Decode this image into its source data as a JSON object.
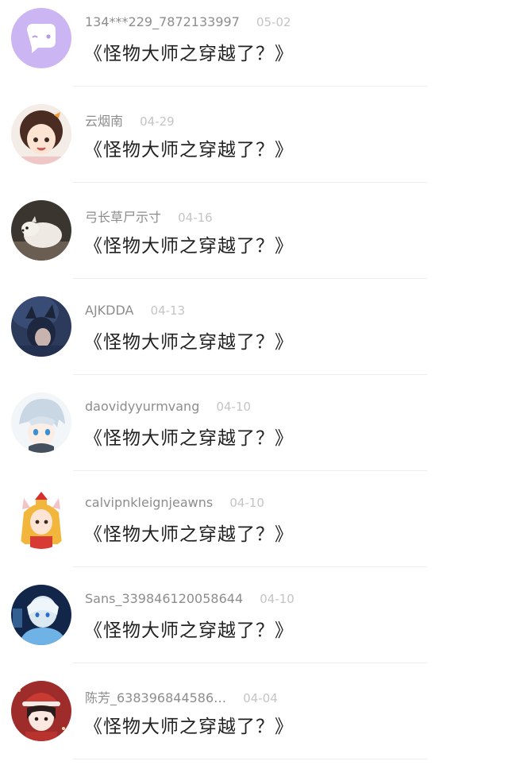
{
  "items": [
    {
      "name": "134***229_7872133997",
      "date": "05-02",
      "title": "《怪物大师之穿越了？》",
      "avatar": "chat-bubble-avatar"
    },
    {
      "name": "云烟南",
      "date": "04-29",
      "title": "《怪物大师之穿越了？》",
      "avatar": "anime-girl-avatar"
    },
    {
      "name": "弓长草尸示寸",
      "date": "04-16",
      "title": "《怪物大师之穿越了？》",
      "avatar": "white-fox-avatar"
    },
    {
      "name": "AJKDDA",
      "date": "04-13",
      "title": "《怪物大师之穿越了？》",
      "avatar": "dark-anime-avatar"
    },
    {
      "name": "daovidyyurmvang",
      "date": "04-10",
      "title": "《怪物大师之穿越了？》",
      "avatar": "silver-hair-avatar"
    },
    {
      "name": "calvipnkleignjeawns",
      "date": "04-10",
      "title": "《怪物大师之穿越了？》",
      "avatar": "golden-queen-avatar"
    },
    {
      "name": "Sans_339846120058644",
      "date": "04-10",
      "title": "《怪物大师之穿越了？》",
      "avatar": "blue-hood-avatar"
    },
    {
      "name": "陈芳_638396844586…",
      "date": "04-04",
      "title": "《怪物大师之穿越了？》",
      "avatar": "red-hat-girl-avatar"
    }
  ]
}
